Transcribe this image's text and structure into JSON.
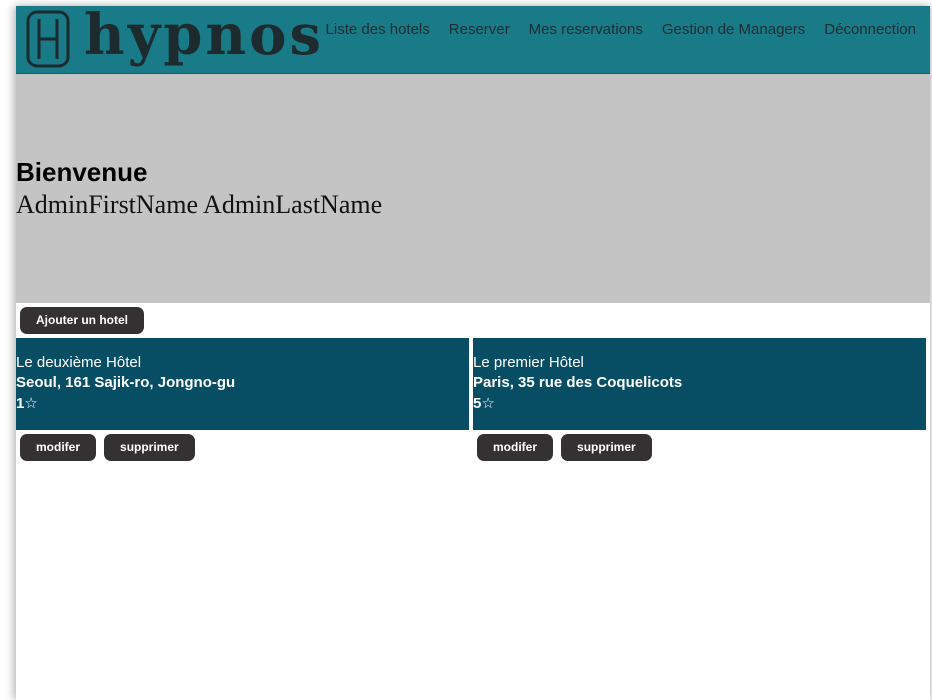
{
  "header": {
    "brand": "hypnos",
    "nav": [
      {
        "label": "Liste des hotels"
      },
      {
        "label": "Reserver"
      },
      {
        "label": "Mes reservations"
      },
      {
        "label": "Gestion de Managers"
      },
      {
        "label": "Déconnection"
      }
    ]
  },
  "hero": {
    "title": "Bienvenue",
    "user_name": "AdminFirstName AdminLastName"
  },
  "actions": {
    "add_hotel_label": "Ajouter un hotel"
  },
  "hotels": [
    {
      "name": "Le deuxième Hôtel",
      "address": "Seoul, 161 Sajik-ro, Jongno-gu",
      "stars": "1☆",
      "edit_label": "modifer",
      "delete_label": "supprimer"
    },
    {
      "name": "Le premier Hôtel",
      "address": "Paris, 35 rue des Coquelicots",
      "stars": "5☆",
      "edit_label": "modifer",
      "delete_label": "supprimer"
    }
  ],
  "colors": {
    "navbar": "#187b87",
    "hero": "#c4c4c4",
    "card": "#074e64",
    "button": "#343132"
  }
}
